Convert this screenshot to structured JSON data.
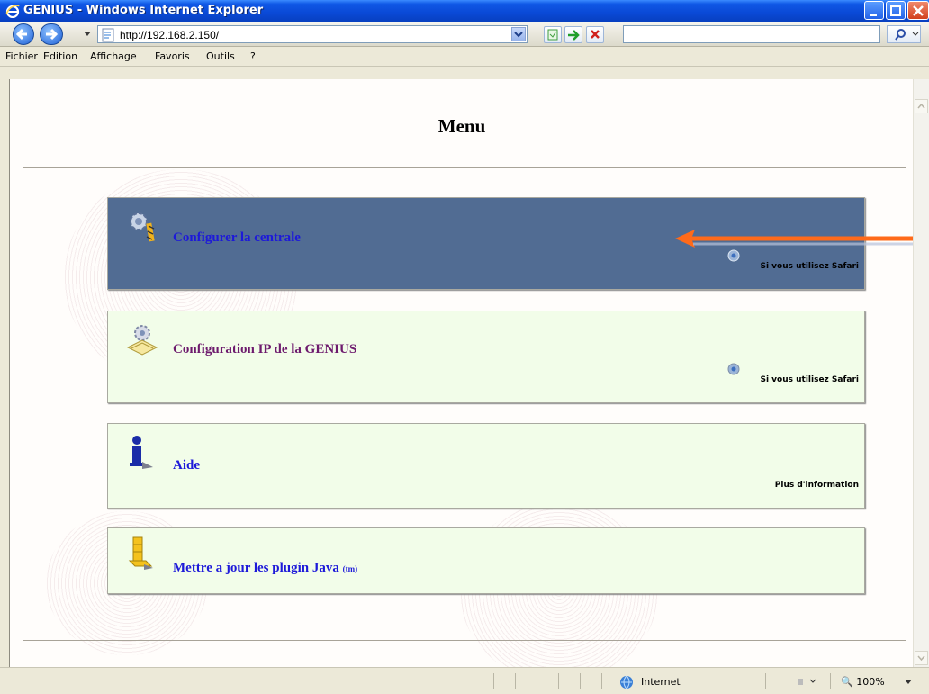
{
  "window": {
    "title": "GENIUS - Windows Internet Explorer"
  },
  "address_bar": {
    "url": "http://192.168.2.150/"
  },
  "menu_bar": {
    "items": [
      "Fichier",
      "Edition",
      "Affichage",
      "Favoris",
      "Outils",
      "?"
    ]
  },
  "page": {
    "title": "Menu",
    "cards": [
      {
        "label": "Configurer la centrale",
        "note": "Si vous utilisez Safari",
        "icon": "gear-config-icon"
      },
      {
        "label": "Configuration IP de la GENIUS",
        "note": "Si vous utilisez Safari",
        "icon": "network-config-icon"
      },
      {
        "label": "Aide",
        "note": "Plus d'information",
        "icon": "info-icon"
      },
      {
        "label": "Mettre a jour les plugin Java",
        "tm": "(tm)",
        "icon": "java-update-icon"
      }
    ]
  },
  "status_bar": {
    "zone": "Internet",
    "zoom": "100%"
  },
  "colors": {
    "highlight_card": "#516c93",
    "card_bg": "#f2fde9",
    "link_blue": "#1d19d9",
    "link_purple": "#6d1a6d",
    "arrow": "#ff6a1a"
  }
}
